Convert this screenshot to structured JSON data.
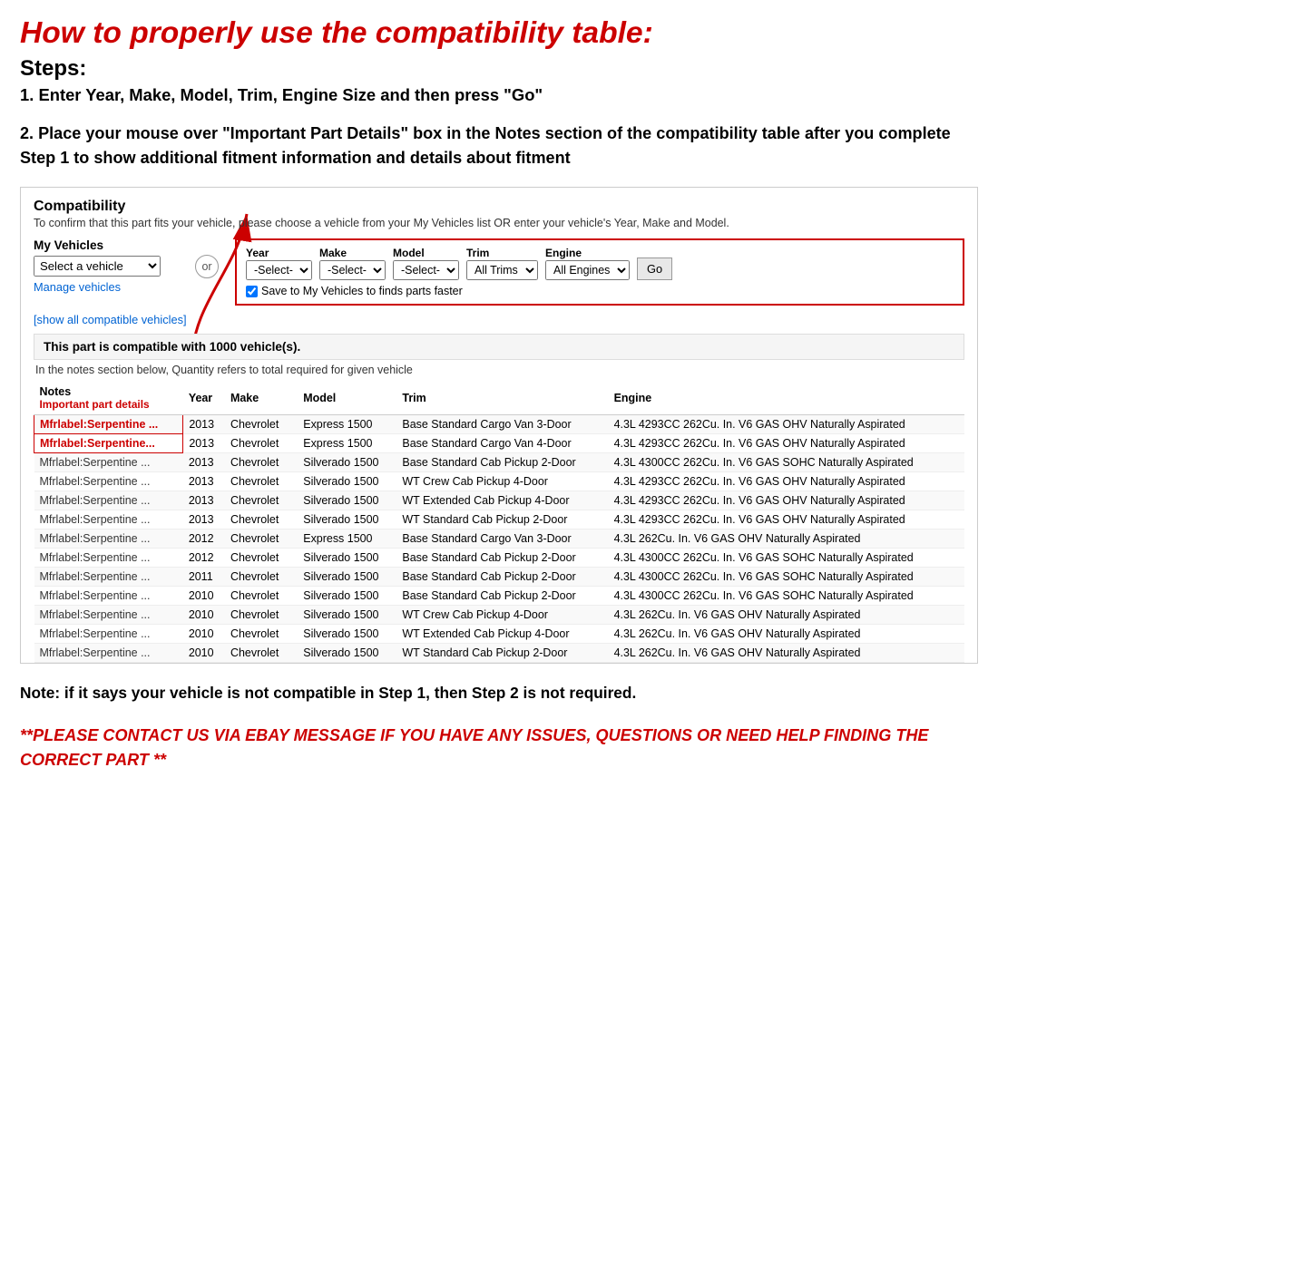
{
  "page": {
    "main_title": "How to properly use the compatibility table:",
    "steps_label": "Steps:",
    "step1": "1. Enter Year, Make, Model, Trim, Engine Size and then press \"Go\"",
    "step2": "2. Place your mouse over \"Important Part Details\" box in the Notes section of the compatibility table after you complete Step 1 to show additional fitment information and details about fitment",
    "note_section": "Note: if it says your vehicle is not compatible in Step 1, then Step 2 is not required.",
    "contact_section": "**PLEASE CONTACT US VIA EBAY MESSAGE IF YOU HAVE ANY ISSUES, QUESTIONS OR NEED HELP FINDING THE CORRECT PART **"
  },
  "compatibility": {
    "title": "Compatibility",
    "subtitle": "To confirm that this part fits your vehicle, please choose a vehicle from your My Vehicles list OR enter your vehicle's Year, Make and Model.",
    "my_vehicles_label": "My Vehicles",
    "select_vehicle_placeholder": "Select a vehicle",
    "manage_vehicles": "Manage vehicles",
    "show_all": "[show all compatible vehicles]",
    "or_label": "or",
    "year_label": "Year",
    "year_value": "-Select-",
    "make_label": "Make",
    "make_value": "-Select-",
    "model_label": "Model",
    "model_value": "-Select-",
    "trim_label": "Trim",
    "trim_value": "All Trims",
    "engine_label": "Engine",
    "engine_value": "All Engines",
    "go_label": "Go",
    "save_checkbox_label": "Save to My Vehicles to finds parts faster",
    "compat_count": "This part is compatible with 1000 vehicle(s).",
    "compat_note": "In the notes section below, Quantity refers to total required for given vehicle",
    "table_headers": [
      "Notes",
      "Year",
      "Make",
      "Model",
      "Trim",
      "Engine"
    ],
    "table_notes_sub": "Important part details",
    "table_rows": [
      {
        "notes": "Mfrlabel:Serpentine ...",
        "year": "2013",
        "make": "Chevrolet",
        "model": "Express 1500",
        "trim": "Base Standard Cargo Van 3-Door",
        "engine": "4.3L 4293CC 262Cu. In. V6 GAS OHV Naturally Aspirated",
        "highlight": true
      },
      {
        "notes": "Mfrlabel:Serpentine...",
        "year": "2013",
        "make": "Chevrolet",
        "model": "Express 1500",
        "trim": "Base Standard Cargo Van 4-Door",
        "engine": "4.3L 4293CC 262Cu. In. V6 GAS OHV Naturally Aspirated",
        "highlight": true
      },
      {
        "notes": "Mfrlabel:Serpentine ...",
        "year": "2013",
        "make": "Chevrolet",
        "model": "Silverado 1500",
        "trim": "Base Standard Cab Pickup 2-Door",
        "engine": "4.3L 4300CC 262Cu. In. V6 GAS SOHC Naturally Aspirated",
        "highlight": false
      },
      {
        "notes": "Mfrlabel:Serpentine ...",
        "year": "2013",
        "make": "Chevrolet",
        "model": "Silverado 1500",
        "trim": "WT Crew Cab Pickup 4-Door",
        "engine": "4.3L 4293CC 262Cu. In. V6 GAS OHV Naturally Aspirated",
        "highlight": false
      },
      {
        "notes": "Mfrlabel:Serpentine ...",
        "year": "2013",
        "make": "Chevrolet",
        "model": "Silverado 1500",
        "trim": "WT Extended Cab Pickup 4-Door",
        "engine": "4.3L 4293CC 262Cu. In. V6 GAS OHV Naturally Aspirated",
        "highlight": false
      },
      {
        "notes": "Mfrlabel:Serpentine ...",
        "year": "2013",
        "make": "Chevrolet",
        "model": "Silverado 1500",
        "trim": "WT Standard Cab Pickup 2-Door",
        "engine": "4.3L 4293CC 262Cu. In. V6 GAS OHV Naturally Aspirated",
        "highlight": false
      },
      {
        "notes": "Mfrlabel:Serpentine ...",
        "year": "2012",
        "make": "Chevrolet",
        "model": "Express 1500",
        "trim": "Base Standard Cargo Van 3-Door",
        "engine": "4.3L 262Cu. In. V6 GAS OHV Naturally Aspirated",
        "highlight": false
      },
      {
        "notes": "Mfrlabel:Serpentine ...",
        "year": "2012",
        "make": "Chevrolet",
        "model": "Silverado 1500",
        "trim": "Base Standard Cab Pickup 2-Door",
        "engine": "4.3L 4300CC 262Cu. In. V6 GAS SOHC Naturally Aspirated",
        "highlight": false
      },
      {
        "notes": "Mfrlabel:Serpentine ...",
        "year": "2011",
        "make": "Chevrolet",
        "model": "Silverado 1500",
        "trim": "Base Standard Cab Pickup 2-Door",
        "engine": "4.3L 4300CC 262Cu. In. V6 GAS SOHC Naturally Aspirated",
        "highlight": false
      },
      {
        "notes": "Mfrlabel:Serpentine ...",
        "year": "2010",
        "make": "Chevrolet",
        "model": "Silverado 1500",
        "trim": "Base Standard Cab Pickup 2-Door",
        "engine": "4.3L 4300CC 262Cu. In. V6 GAS SOHC Naturally Aspirated",
        "highlight": false
      },
      {
        "notes": "Mfrlabel:Serpentine ...",
        "year": "2010",
        "make": "Chevrolet",
        "model": "Silverado 1500",
        "trim": "WT Crew Cab Pickup 4-Door",
        "engine": "4.3L 262Cu. In. V6 GAS OHV Naturally Aspirated",
        "highlight": false
      },
      {
        "notes": "Mfrlabel:Serpentine ...",
        "year": "2010",
        "make": "Chevrolet",
        "model": "Silverado 1500",
        "trim": "WT Extended Cab Pickup 4-Door",
        "engine": "4.3L 262Cu. In. V6 GAS OHV Naturally Aspirated",
        "highlight": false
      },
      {
        "notes": "Mfrlabel:Serpentine ...",
        "year": "2010",
        "make": "Chevrolet",
        "model": "Silverado 1500",
        "trim": "WT Standard Cab Pickup 2-Door",
        "engine": "4.3L 262Cu. In. V6 GAS OHV Naturally Aspirated",
        "highlight": false
      }
    ]
  }
}
